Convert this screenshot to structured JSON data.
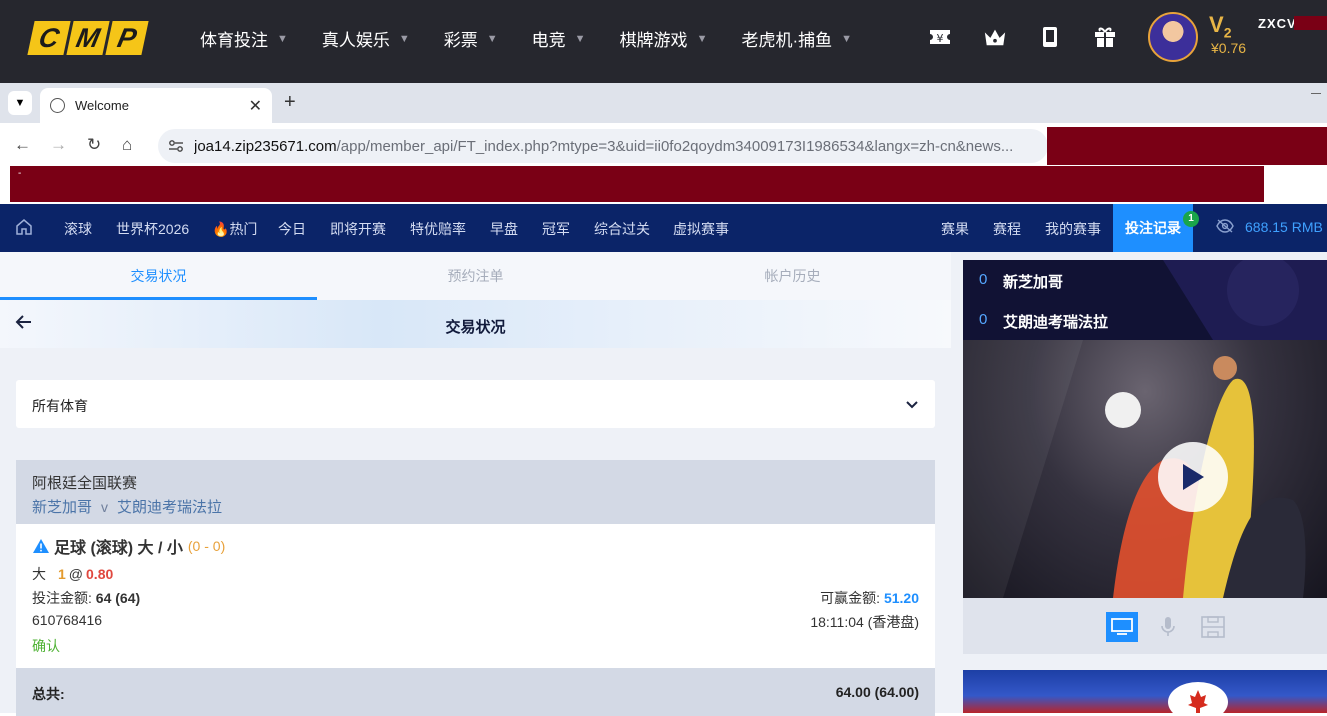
{
  "site": {
    "logo_letters": [
      "C",
      "M",
      "P"
    ],
    "nav": [
      "体育投注",
      "真人娱乐",
      "彩票",
      "电竞",
      "棋牌游戏",
      "老虎机·捕鱼"
    ],
    "vip_level": "V",
    "vip_number": "2",
    "balance": "¥0.76",
    "username": "ZXCV",
    "icons": [
      "ticket-icon",
      "crown-icon",
      "mobile-icon",
      "gift-icon"
    ]
  },
  "browser": {
    "tab_title": "Welcome",
    "url_domain": "joa14.zip235671.com",
    "url_path": "/app/member_api/FT_index.php?mtype=3&uid=ii0fo2qoydm34009173I1986534&langx=zh-cn&news...",
    "overlay_mark": "-",
    "redact_color": "#7a0015"
  },
  "sitenav": {
    "items": [
      "滚球",
      "世界杯2026",
      "热门",
      "今日",
      "即将开赛",
      "特优赔率",
      "早盘",
      "冠军",
      "综合过关",
      "虚拟赛事"
    ],
    "right_items": [
      "赛果",
      "赛程",
      "我的赛事"
    ],
    "bet_record": "投注记录",
    "bet_record_badge": "1",
    "balance": "688.15",
    "currency": "RMB",
    "accent": "#1e8fff",
    "bg": "#0b2468"
  },
  "subtabs": [
    "交易状况",
    "预约注单",
    "帐户历史"
  ],
  "page_title": "交易状况",
  "sport_filter": "所有体育",
  "bet": {
    "league": "阿根廷全国联赛",
    "home": "新芝加哥",
    "vs": "v",
    "away": "艾朗迪考瑞法拉",
    "market": "足球 (滚球) 大 / 小",
    "score": "(0 - 0)",
    "selection": "大",
    "line": "1",
    "at": "@",
    "odds": "0.80",
    "stake_label": "投注金额:",
    "stake": "64 (64)",
    "win_label": "可赢金额:",
    "win": "51.20",
    "ticket_id": "610768416",
    "time": "18:11:04 (香港盘)",
    "status": "确认"
  },
  "total": {
    "label": "总共:",
    "value": "64.00 (64.00)"
  },
  "live": {
    "home_score": "0",
    "home": "新芝加哥",
    "away_score": "0",
    "away": "艾朗迪考瑞法拉"
  }
}
